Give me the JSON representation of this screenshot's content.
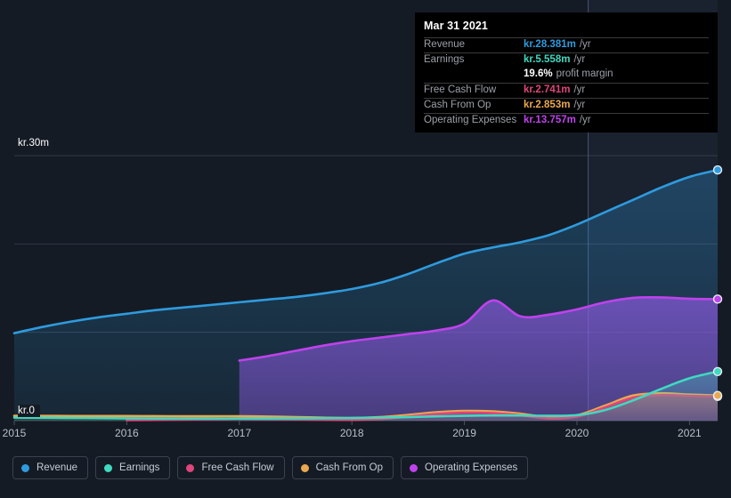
{
  "axis": {
    "y_top_label": "kr.30m",
    "y_zero_label": "kr.0",
    "x_ticks": [
      "2015",
      "2016",
      "2017",
      "2018",
      "2019",
      "2020",
      "2021"
    ]
  },
  "tooltip": {
    "date": "Mar 31 2021",
    "rows": [
      {
        "label": "Revenue",
        "value": "kr.28.381m",
        "unit": "/yr",
        "color": "#2e9bde"
      },
      {
        "label": "Earnings",
        "value": "kr.5.558m",
        "unit": "/yr",
        "color": "#3fd9c0"
      },
      {
        "label": "Free Cash Flow",
        "value": "kr.2.741m",
        "unit": "/yr",
        "color": "#e0457b"
      },
      {
        "label": "Cash From Op",
        "value": "kr.2.853m",
        "unit": "/yr",
        "color": "#eaa84f"
      },
      {
        "label": "Operating Expenses",
        "value": "kr.13.757m",
        "unit": "/yr",
        "color": "#bf42ec"
      }
    ],
    "margin_value": "19.6%",
    "margin_label": "profit margin"
  },
  "legend": [
    {
      "label": "Revenue",
      "color": "#2e9bde"
    },
    {
      "label": "Earnings",
      "color": "#3fd9c0"
    },
    {
      "label": "Free Cash Flow",
      "color": "#e0457b"
    },
    {
      "label": "Cash From Op",
      "color": "#eaa84f"
    },
    {
      "label": "Operating Expenses",
      "color": "#bf42ec"
    }
  ],
  "chart_data": {
    "type": "area",
    "title": "",
    "xlabel": "",
    "ylabel": "kr",
    "ylim": [
      0,
      30
    ],
    "y_unit": "m",
    "currency": "kr",
    "grid": true,
    "gridlines_y": [
      0,
      10,
      20,
      30
    ],
    "legend_position": "bottom",
    "forecast_start": "2020.1",
    "x": [
      2015.0,
      2015.25,
      2015.5,
      2015.75,
      2016.0,
      2016.25,
      2016.5,
      2016.75,
      2017.0,
      2017.25,
      2017.5,
      2017.75,
      2018.0,
      2018.25,
      2018.5,
      2018.75,
      2019.0,
      2019.25,
      2019.5,
      2019.75,
      2020.0,
      2020.25,
      2020.5,
      2020.75,
      2021.0,
      2021.25
    ],
    "series": [
      {
        "name": "Revenue",
        "color": "#2e9bde",
        "values": [
          9.9,
          10.6,
          11.2,
          11.7,
          12.1,
          12.5,
          12.8,
          13.1,
          13.4,
          13.7,
          14.0,
          14.4,
          14.9,
          15.6,
          16.6,
          17.8,
          18.9,
          19.6,
          20.2,
          21.0,
          22.2,
          23.6,
          25.0,
          26.4,
          27.6,
          28.381
        ]
      },
      {
        "name": "Earnings",
        "color": "#3fd9c0",
        "values": [
          0.35,
          0.32,
          0.3,
          0.28,
          0.26,
          0.25,
          0.24,
          0.24,
          0.24,
          0.25,
          0.26,
          0.28,
          0.3,
          0.34,
          0.4,
          0.48,
          0.55,
          0.58,
          0.58,
          0.55,
          0.62,
          1.2,
          2.3,
          3.6,
          4.8,
          5.558
        ]
      },
      {
        "name": "Free Cash Flow",
        "color": "#e0457b",
        "values": [
          null,
          null,
          null,
          null,
          0.05,
          0.08,
          0.12,
          0.16,
          0.2,
          0.18,
          0.14,
          0.1,
          0.08,
          0.18,
          0.45,
          0.75,
          0.9,
          0.85,
          0.6,
          0.25,
          0.45,
          1.5,
          2.6,
          2.9,
          2.8,
          2.741
        ]
      },
      {
        "name": "Cash From Op",
        "color": "#eaa84f",
        "values": [
          0.55,
          0.54,
          0.53,
          0.52,
          0.52,
          0.51,
          0.5,
          0.5,
          0.5,
          0.46,
          0.4,
          0.34,
          0.3,
          0.4,
          0.65,
          0.95,
          1.1,
          1.05,
          0.78,
          0.4,
          0.6,
          1.7,
          2.85,
          3.1,
          2.95,
          2.853
        ]
      },
      {
        "name": "Operating Expenses",
        "color": "#bf42ec",
        "values": [
          null,
          null,
          null,
          null,
          null,
          null,
          null,
          null,
          6.8,
          7.3,
          7.9,
          8.5,
          9.0,
          9.4,
          9.8,
          10.2,
          11.0,
          13.6,
          11.8,
          12.0,
          12.6,
          13.4,
          13.9,
          13.95,
          13.8,
          13.757
        ]
      }
    ]
  }
}
